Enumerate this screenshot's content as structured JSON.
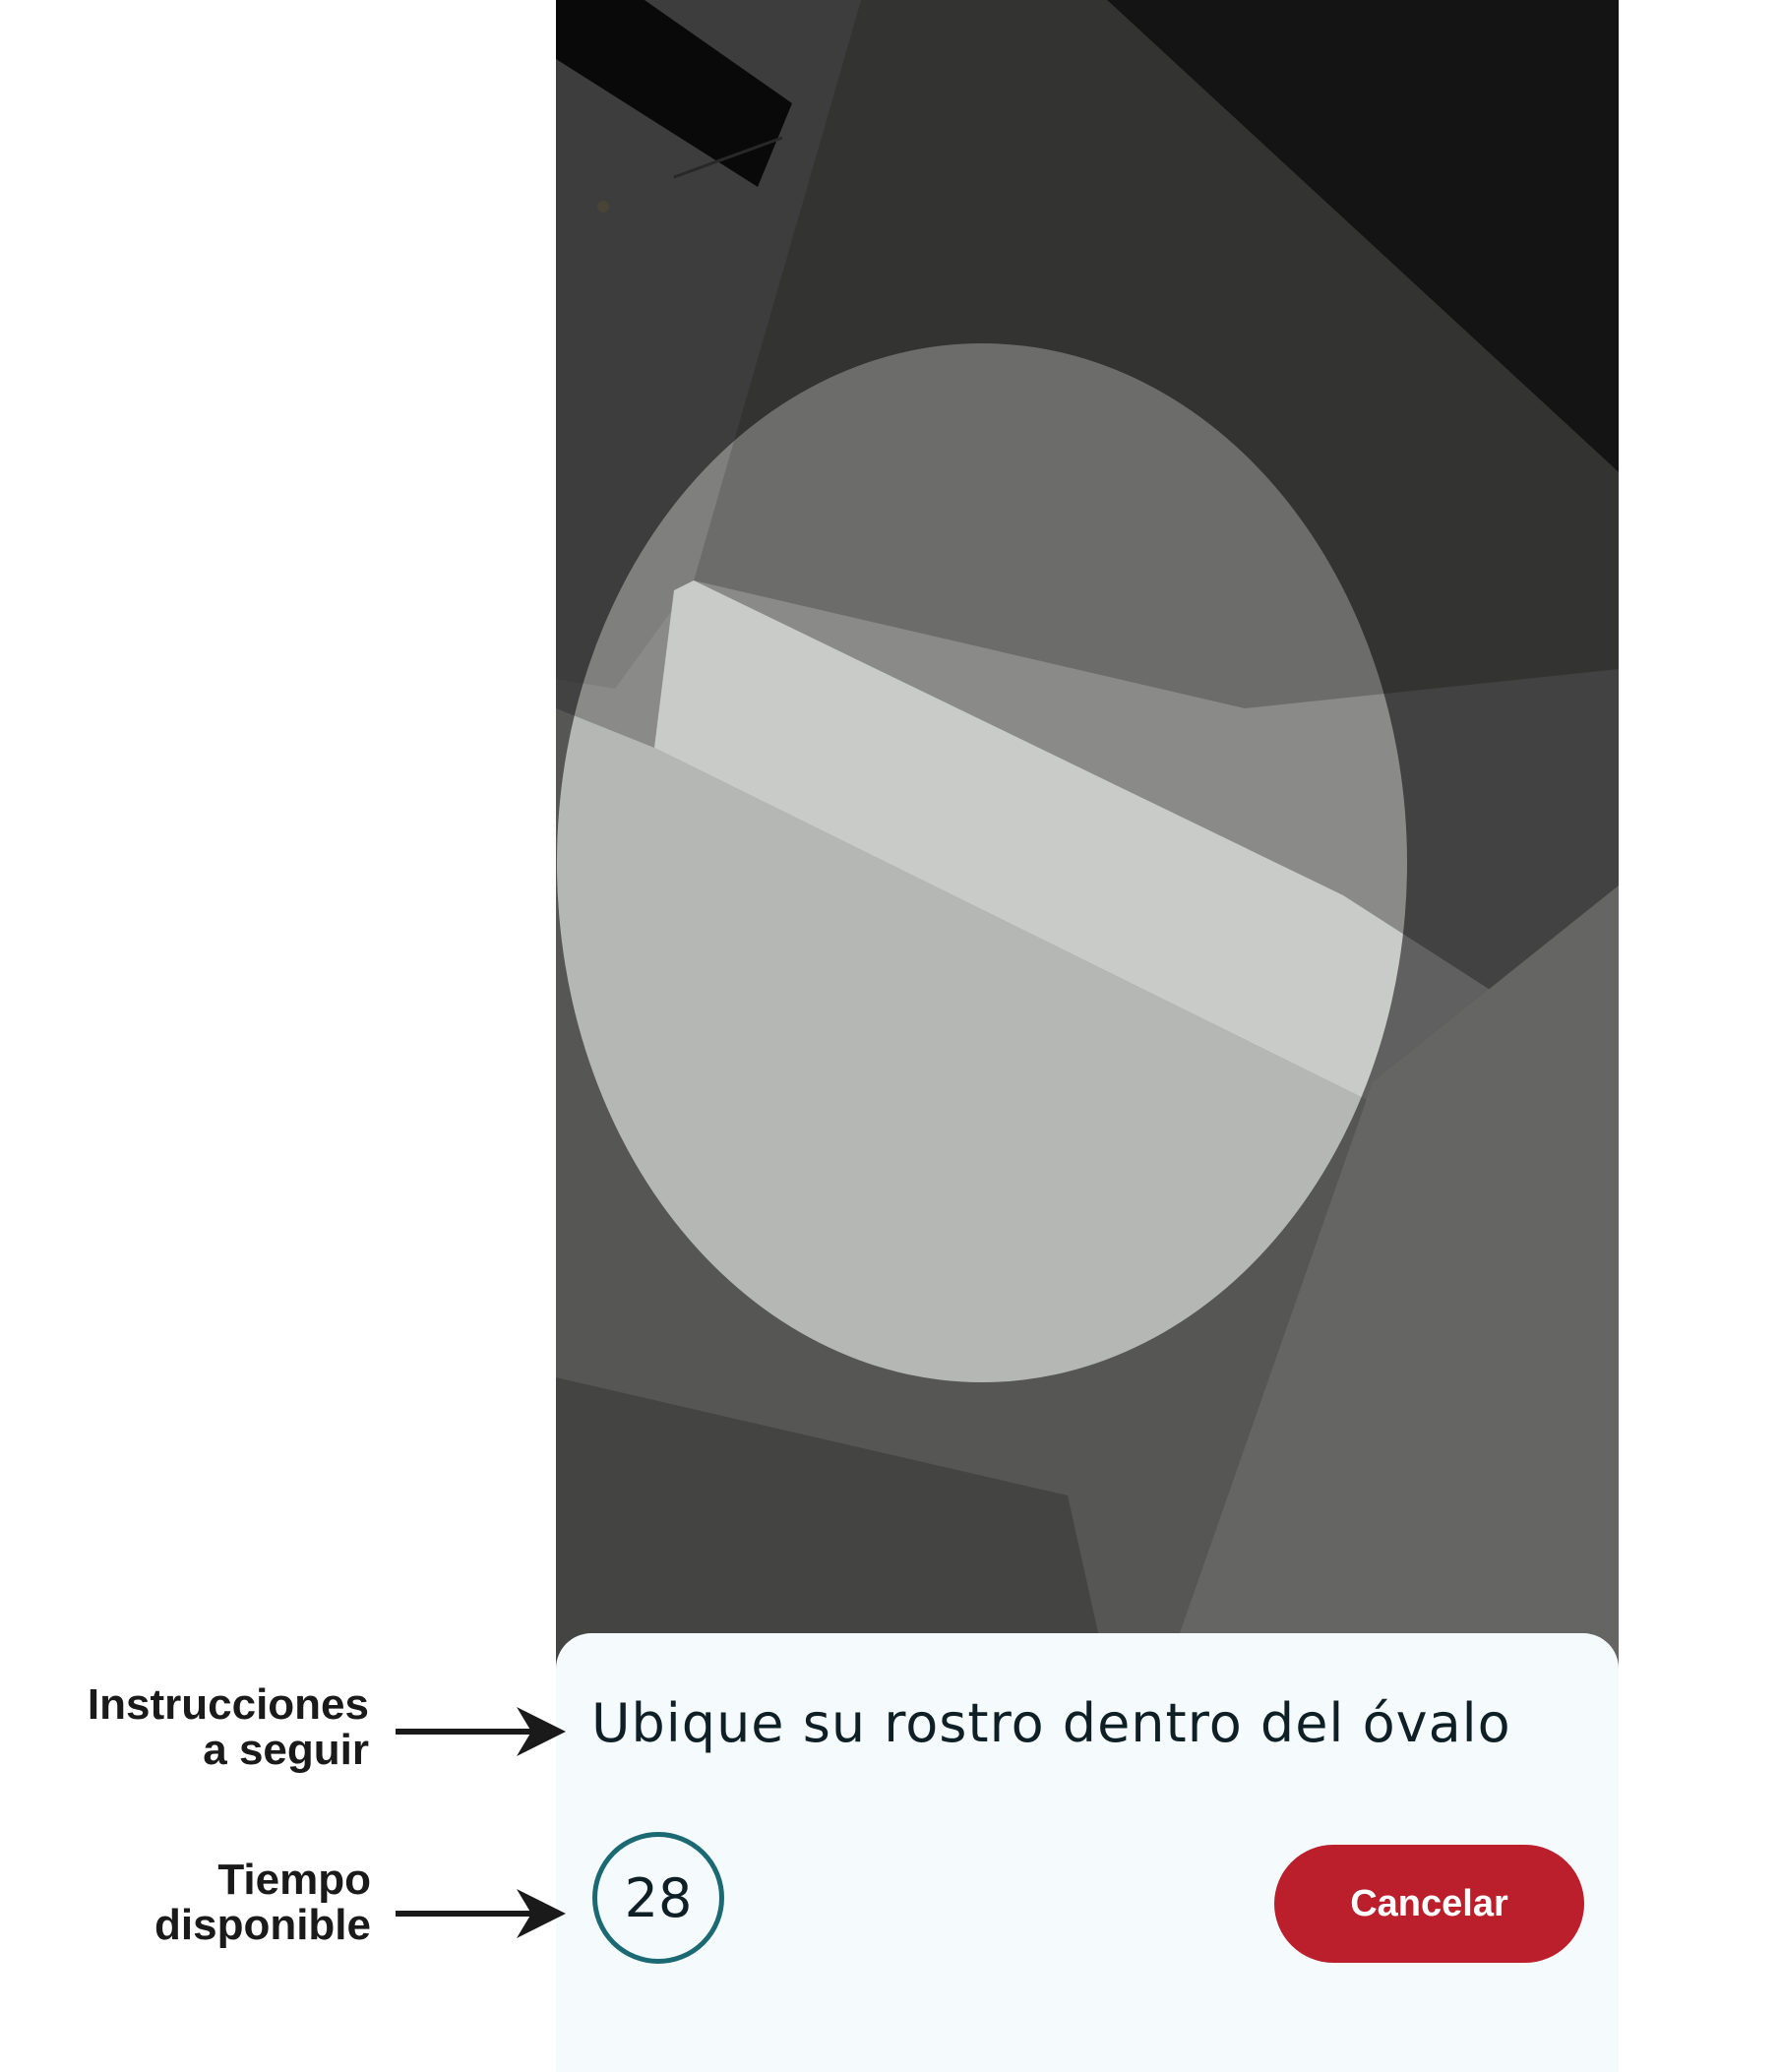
{
  "screen": {
    "instruction": "Ubique su rostro dentro del óvalo",
    "timer_value": "28",
    "cancel_label": "Cancelar"
  },
  "annotations": [
    {
      "line1": "Instrucciones",
      "line2": "a seguir"
    },
    {
      "line1": "Tiempo",
      "line2": "disponible"
    }
  ],
  "colors": {
    "cancel_button": "#bb1f2c",
    "timer_ring": "#1b6a73",
    "sheet_background": "#f5fafc"
  }
}
